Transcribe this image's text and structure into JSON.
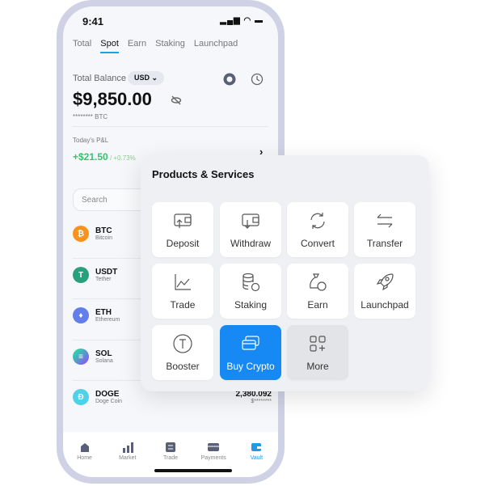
{
  "status": {
    "time": "9:41",
    "icons": "signal wifi battery"
  },
  "tabs": [
    "Total",
    "Spot",
    "Earn",
    "Staking",
    "Launchpad"
  ],
  "active_tab": "Spot",
  "balance": {
    "label": "Total Balance",
    "currency": "USD",
    "amount": "$9,850.00",
    "btc": "******** BTC"
  },
  "pnl": {
    "label": "Today's P&L",
    "value": "+$21.50",
    "percent": " / +0.73%"
  },
  "search": {
    "placeholder": "Search"
  },
  "coins": [
    {
      "symbol": "BTC",
      "name": "Bitcoin",
      "color": "#f7931a",
      "glyph": "₿"
    },
    {
      "symbol": "USDT",
      "name": "Tether",
      "color": "#26a17b",
      "glyph": "T"
    },
    {
      "symbol": "ETH",
      "name": "Ethereum",
      "color": "#627eea",
      "glyph": "♦"
    },
    {
      "symbol": "SOL",
      "name": "Solana",
      "color": "#9945ff",
      "glyph": "≡"
    },
    {
      "symbol": "DOGE",
      "name": "Doge Coin",
      "color": "#4fd1e8",
      "glyph": "Ð",
      "amount": "2,380.092",
      "usd": "$********"
    }
  ],
  "nav": [
    "Home",
    "Market",
    "Trade",
    "Payments",
    "Vault"
  ],
  "active_nav": "Vault",
  "panel": {
    "title": "Products & Services",
    "tiles": [
      "Deposit",
      "Withdraw",
      "Convert",
      "Transfer",
      "Trade",
      "Staking",
      "Earn",
      "Launchpad",
      "Booster",
      "Buy Crypto",
      "More"
    ]
  },
  "colors": {
    "accent": "#1689f5",
    "positive": "#3cbf70"
  }
}
